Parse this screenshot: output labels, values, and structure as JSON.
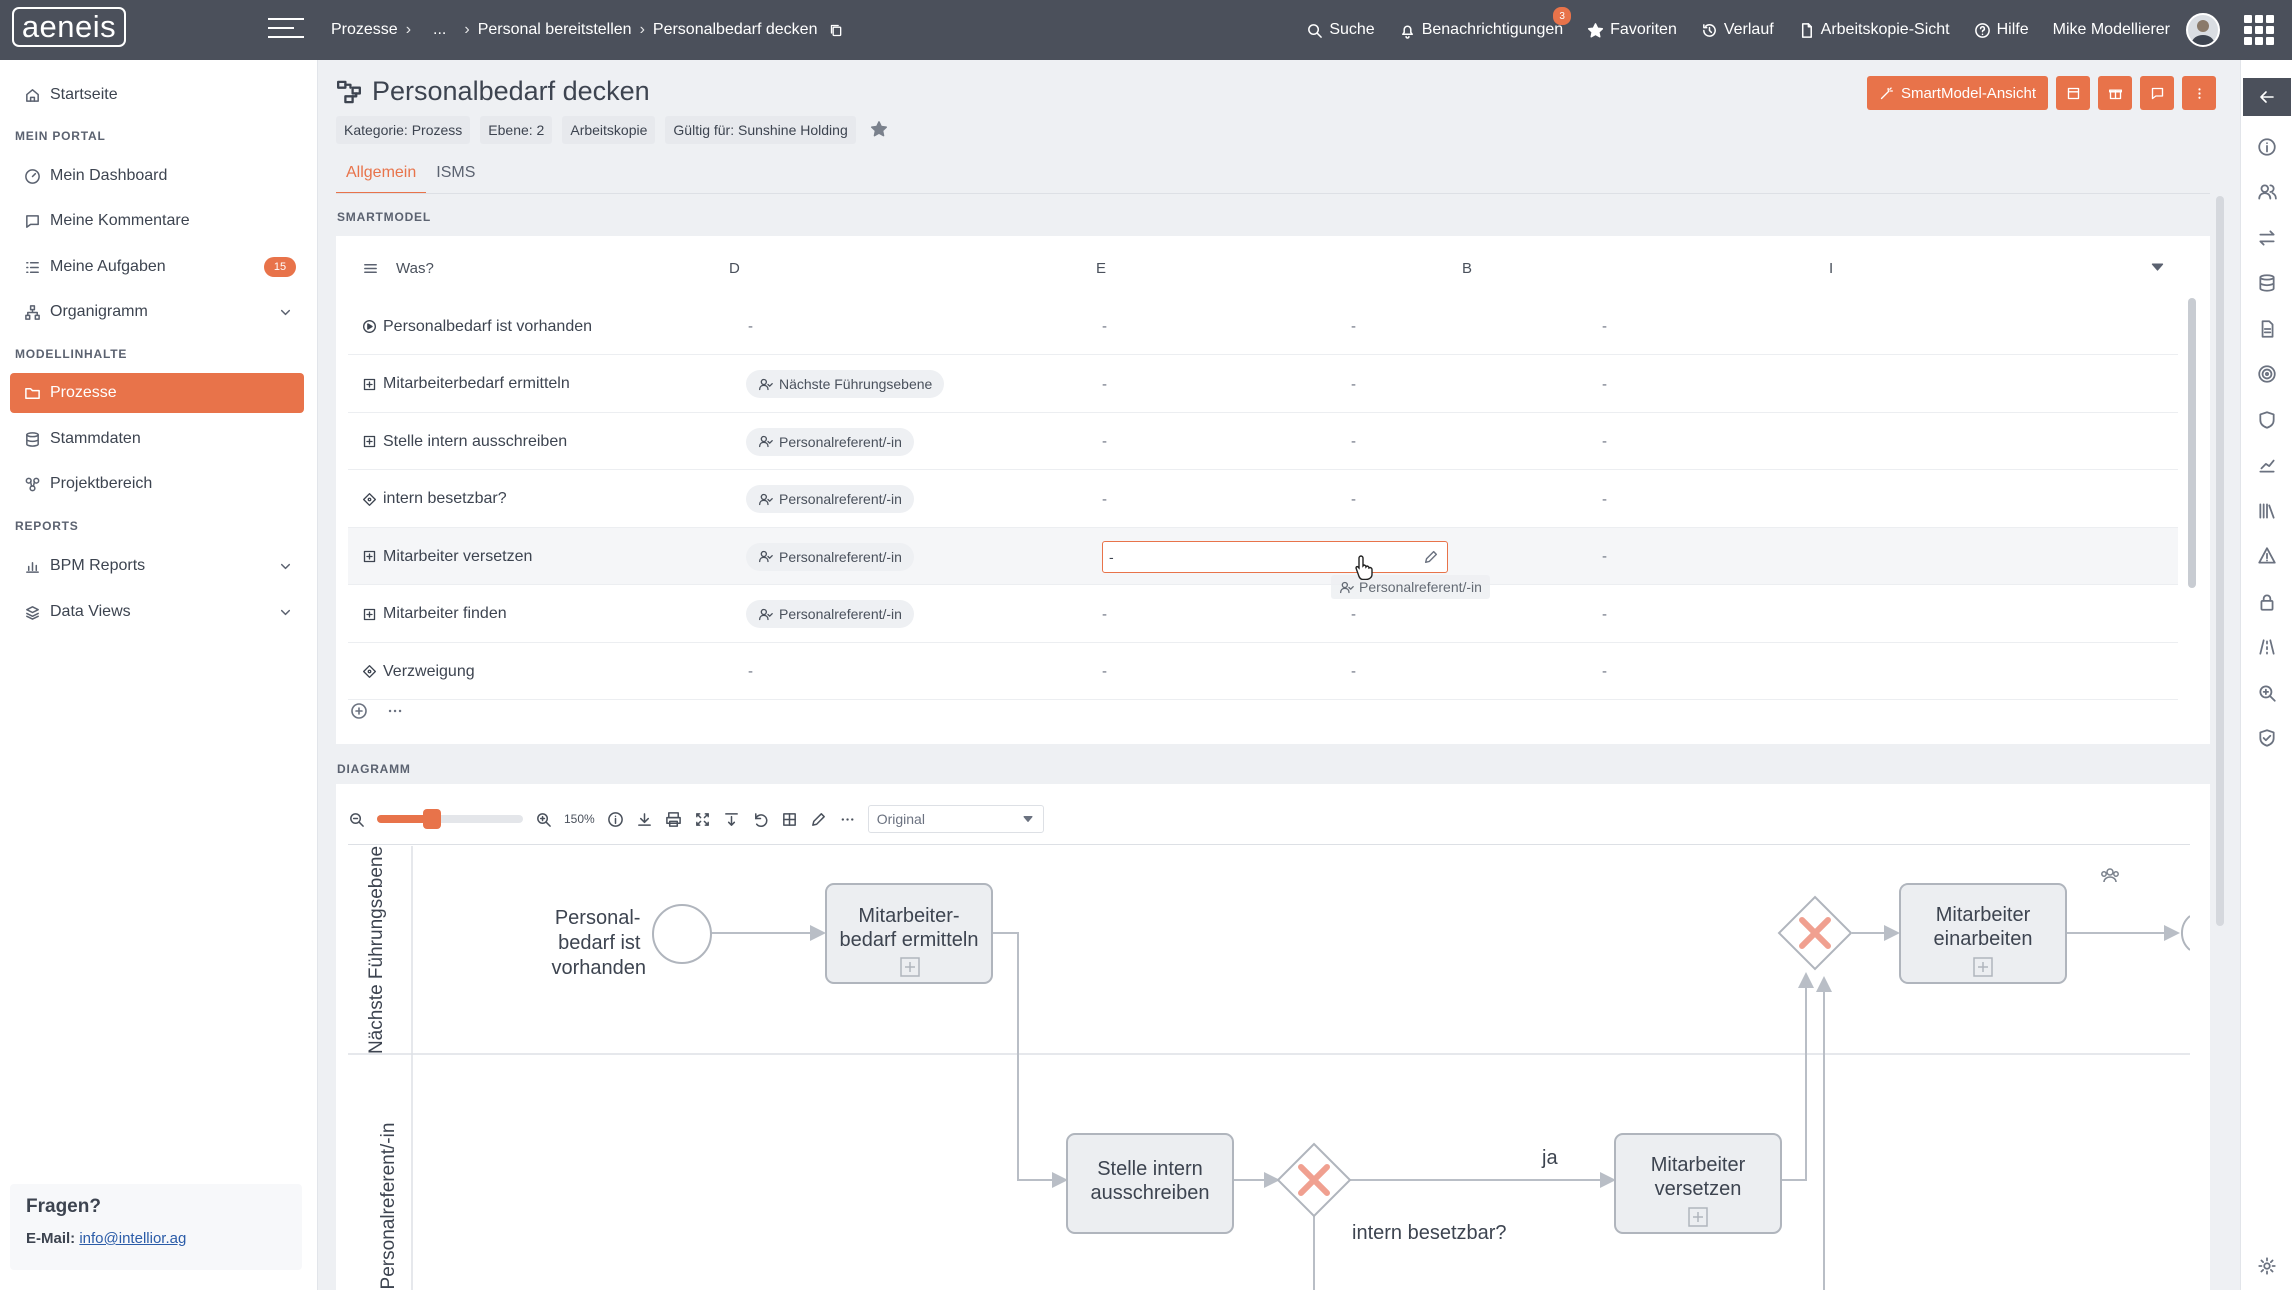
{
  "app": {
    "logo_text": "aeneis"
  },
  "breadcrumb": {
    "items": [
      "Prozesse",
      "...",
      "Personal bereitstellen",
      "Personalbedarf decken"
    ]
  },
  "topnav": {
    "search": "Suche",
    "notifications": "Benachrichtigungen",
    "notifications_count": "3",
    "favorites": "Favoriten",
    "history": "Verlauf",
    "workcopy": "Arbeitskopie-Sicht",
    "help": "Hilfe",
    "user": "Mike Modellierer"
  },
  "sidebar": {
    "startseite": "Startseite",
    "section_portal": "MEIN PORTAL",
    "dashboard": "Mein Dashboard",
    "kommentare": "Meine Kommentare",
    "aufgaben": "Meine Aufgaben",
    "aufgaben_count": "15",
    "organigramm": "Organigramm",
    "section_model": "MODELLINHALTE",
    "prozesse": "Prozesse",
    "stammdaten": "Stammdaten",
    "projektbereich": "Projektbereich",
    "section_reports": "REPORTS",
    "bpm_reports": "BPM Reports",
    "data_views": "Data Views",
    "help_title": "Fragen?",
    "help_email_label": "E-Mail:",
    "help_email": "info@intellior.ag"
  },
  "page": {
    "title": "Personalbedarf decken",
    "meta": [
      "Kategorie: Prozess",
      "Ebene: 2",
      "Arbeitskopie",
      "Gültig für: Sunshine Holding"
    ],
    "smartmodel_button": "SmartModel-Ansicht",
    "tabs": [
      "Allgemein",
      "ISMS"
    ],
    "active_tab": "Allgemein"
  },
  "smartmodel": {
    "section_label": "SMARTMODEL",
    "headers": {
      "what": "Was?",
      "d": "D",
      "e": "E",
      "b": "B",
      "i": "I"
    },
    "rows": [
      {
        "label": "Personalbedarf ist vorhanden",
        "icon": "play-circle-icon",
        "d": "-",
        "e": "-",
        "b": "-",
        "i": "-"
      },
      {
        "label": "Mitarbeiterbedarf ermitteln",
        "icon": "plus-square-icon",
        "d": "Nächste Führungsebene",
        "e": "-",
        "b": "-",
        "i": "-"
      },
      {
        "label": "Stelle intern ausschreiben",
        "icon": "plus-square-icon",
        "d": "Personalreferent/-in",
        "e": "-",
        "b": "-",
        "i": "-"
      },
      {
        "label": "intern besetzbar?",
        "icon": "diamond-icon",
        "d": "Personalreferent/-in",
        "e": "-",
        "b": "-",
        "i": "-"
      },
      {
        "label": "Mitarbeiter versetzen",
        "icon": "plus-square-icon",
        "d": "Personalreferent/-in",
        "e": "-",
        "b": "-",
        "i": "-"
      },
      {
        "label": "Mitarbeiter finden",
        "icon": "plus-square-icon",
        "d": "Personalreferent/-in",
        "e": "-",
        "b": "-",
        "i": "-"
      },
      {
        "label": "Verzweigung",
        "icon": "diamond-icon",
        "d": "-",
        "e": "-",
        "b": "-",
        "i": "-"
      }
    ],
    "editing_value": "-",
    "drag_suggestion": "Personalreferent/-in"
  },
  "diagram": {
    "section_label": "DIAGRAMM",
    "zoom_level": "150%",
    "zoom_fraction": 0.38,
    "view_option": "Original",
    "lanes": [
      "Nächste Führungsebene",
      "Personalreferent/-in"
    ],
    "nodes": {
      "start_event": [
        "Personal-",
        "bedarf ist",
        "vorhanden"
      ],
      "task_1": [
        "Mitarbeiter-",
        "bedarf ermitteln"
      ],
      "task_2": [
        "Stelle intern",
        "ausschreiben"
      ],
      "task_3": [
        "Mitarbeiter",
        "versetzen"
      ],
      "task_4": [
        "Mitarbeiter",
        "einarbeiten"
      ],
      "gateway_label": "intern besetzbar?",
      "edge_label_yes": "ja"
    }
  }
}
